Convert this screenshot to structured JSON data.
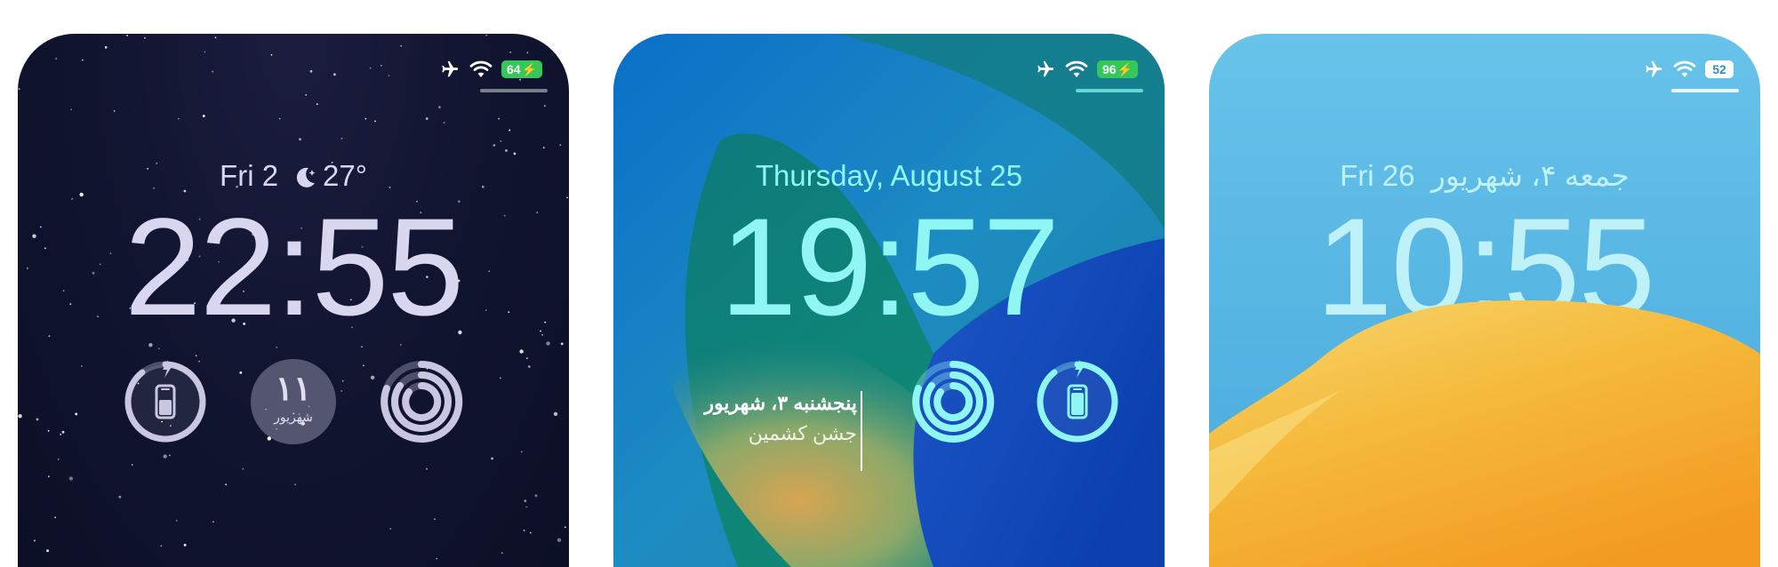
{
  "screens": [
    {
      "status": {
        "battery": "64",
        "battery_style": "charging-green",
        "icons": [
          "airplane-icon",
          "wifi-icon",
          "battery-icon"
        ]
      },
      "date_label": "Fri 2",
      "weather_temp": "27°",
      "time": "22:55",
      "widgets": [
        {
          "icon": "phone-battery-icon",
          "charging": true
        },
        {
          "day_number": "۱۱",
          "month": "شهریور"
        },
        {
          "icon": "activity-rings-icon"
        }
      ],
      "colors": {
        "text": "#d9d7f0",
        "widget_ring": "#bdbbd6"
      }
    },
    {
      "status": {
        "battery": "96",
        "battery_style": "charging-green",
        "icons": [
          "airplane-icon",
          "wifi-icon",
          "battery-icon"
        ]
      },
      "date_label": "Thursday, August 25",
      "time": "19:57",
      "calendar_widget": {
        "date": "پنجشنبه ۳، شهریور",
        "event": "جشن کشمین"
      },
      "widgets": [
        {
          "icon": "activity-rings-icon"
        },
        {
          "icon": "phone-battery-icon",
          "charging": true
        }
      ],
      "colors": {
        "text": "#8ff6f4"
      }
    },
    {
      "status": {
        "battery": "52",
        "battery_style": "white",
        "icons": [
          "airplane-icon",
          "wifi-icon",
          "battery-icon"
        ]
      },
      "date_label": "Fri 26",
      "date_secondary": "جمعه ۴، شهریور",
      "time": "10:55",
      "colors": {
        "text": "#bff2f8"
      }
    }
  ]
}
